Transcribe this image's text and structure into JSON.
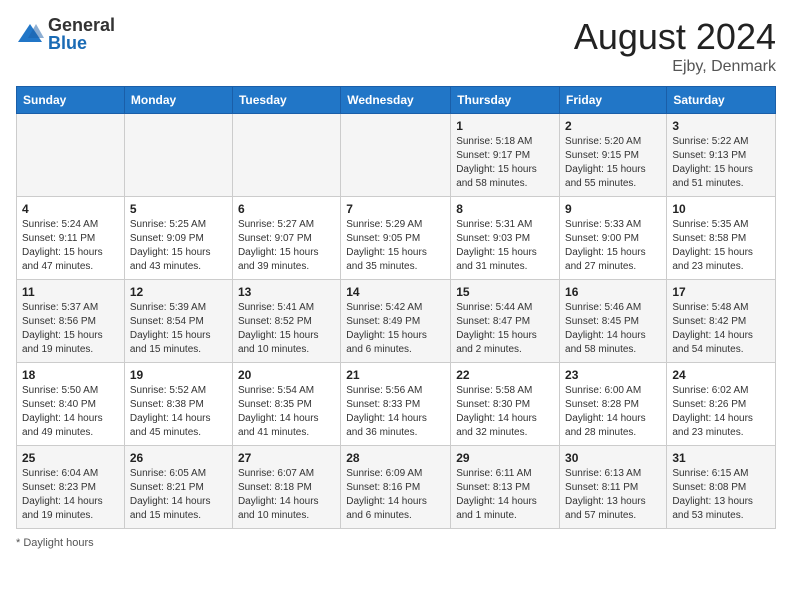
{
  "header": {
    "logo_general": "General",
    "logo_blue": "Blue",
    "month_title": "August 2024",
    "location": "Ejby, Denmark"
  },
  "days_of_week": [
    "Sunday",
    "Monday",
    "Tuesday",
    "Wednesday",
    "Thursday",
    "Friday",
    "Saturday"
  ],
  "weeks": [
    [
      {
        "day": "",
        "info": ""
      },
      {
        "day": "",
        "info": ""
      },
      {
        "day": "",
        "info": ""
      },
      {
        "day": "",
        "info": ""
      },
      {
        "day": "1",
        "info": "Sunrise: 5:18 AM\nSunset: 9:17 PM\nDaylight: 15 hours\nand 58 minutes."
      },
      {
        "day": "2",
        "info": "Sunrise: 5:20 AM\nSunset: 9:15 PM\nDaylight: 15 hours\nand 55 minutes."
      },
      {
        "day": "3",
        "info": "Sunrise: 5:22 AM\nSunset: 9:13 PM\nDaylight: 15 hours\nand 51 minutes."
      }
    ],
    [
      {
        "day": "4",
        "info": "Sunrise: 5:24 AM\nSunset: 9:11 PM\nDaylight: 15 hours\nand 47 minutes."
      },
      {
        "day": "5",
        "info": "Sunrise: 5:25 AM\nSunset: 9:09 PM\nDaylight: 15 hours\nand 43 minutes."
      },
      {
        "day": "6",
        "info": "Sunrise: 5:27 AM\nSunset: 9:07 PM\nDaylight: 15 hours\nand 39 minutes."
      },
      {
        "day": "7",
        "info": "Sunrise: 5:29 AM\nSunset: 9:05 PM\nDaylight: 15 hours\nand 35 minutes."
      },
      {
        "day": "8",
        "info": "Sunrise: 5:31 AM\nSunset: 9:03 PM\nDaylight: 15 hours\nand 31 minutes."
      },
      {
        "day": "9",
        "info": "Sunrise: 5:33 AM\nSunset: 9:00 PM\nDaylight: 15 hours\nand 27 minutes."
      },
      {
        "day": "10",
        "info": "Sunrise: 5:35 AM\nSunset: 8:58 PM\nDaylight: 15 hours\nand 23 minutes."
      }
    ],
    [
      {
        "day": "11",
        "info": "Sunrise: 5:37 AM\nSunset: 8:56 PM\nDaylight: 15 hours\nand 19 minutes."
      },
      {
        "day": "12",
        "info": "Sunrise: 5:39 AM\nSunset: 8:54 PM\nDaylight: 15 hours\nand 15 minutes."
      },
      {
        "day": "13",
        "info": "Sunrise: 5:41 AM\nSunset: 8:52 PM\nDaylight: 15 hours\nand 10 minutes."
      },
      {
        "day": "14",
        "info": "Sunrise: 5:42 AM\nSunset: 8:49 PM\nDaylight: 15 hours\nand 6 minutes."
      },
      {
        "day": "15",
        "info": "Sunrise: 5:44 AM\nSunset: 8:47 PM\nDaylight: 15 hours\nand 2 minutes."
      },
      {
        "day": "16",
        "info": "Sunrise: 5:46 AM\nSunset: 8:45 PM\nDaylight: 14 hours\nand 58 minutes."
      },
      {
        "day": "17",
        "info": "Sunrise: 5:48 AM\nSunset: 8:42 PM\nDaylight: 14 hours\nand 54 minutes."
      }
    ],
    [
      {
        "day": "18",
        "info": "Sunrise: 5:50 AM\nSunset: 8:40 PM\nDaylight: 14 hours\nand 49 minutes."
      },
      {
        "day": "19",
        "info": "Sunrise: 5:52 AM\nSunset: 8:38 PM\nDaylight: 14 hours\nand 45 minutes."
      },
      {
        "day": "20",
        "info": "Sunrise: 5:54 AM\nSunset: 8:35 PM\nDaylight: 14 hours\nand 41 minutes."
      },
      {
        "day": "21",
        "info": "Sunrise: 5:56 AM\nSunset: 8:33 PM\nDaylight: 14 hours\nand 36 minutes."
      },
      {
        "day": "22",
        "info": "Sunrise: 5:58 AM\nSunset: 8:30 PM\nDaylight: 14 hours\nand 32 minutes."
      },
      {
        "day": "23",
        "info": "Sunrise: 6:00 AM\nSunset: 8:28 PM\nDaylight: 14 hours\nand 28 minutes."
      },
      {
        "day": "24",
        "info": "Sunrise: 6:02 AM\nSunset: 8:26 PM\nDaylight: 14 hours\nand 23 minutes."
      }
    ],
    [
      {
        "day": "25",
        "info": "Sunrise: 6:04 AM\nSunset: 8:23 PM\nDaylight: 14 hours\nand 19 minutes."
      },
      {
        "day": "26",
        "info": "Sunrise: 6:05 AM\nSunset: 8:21 PM\nDaylight: 14 hours\nand 15 minutes."
      },
      {
        "day": "27",
        "info": "Sunrise: 6:07 AM\nSunset: 8:18 PM\nDaylight: 14 hours\nand 10 minutes."
      },
      {
        "day": "28",
        "info": "Sunrise: 6:09 AM\nSunset: 8:16 PM\nDaylight: 14 hours\nand 6 minutes."
      },
      {
        "day": "29",
        "info": "Sunrise: 6:11 AM\nSunset: 8:13 PM\nDaylight: 14 hours\nand 1 minute."
      },
      {
        "day": "30",
        "info": "Sunrise: 6:13 AM\nSunset: 8:11 PM\nDaylight: 13 hours\nand 57 minutes."
      },
      {
        "day": "31",
        "info": "Sunrise: 6:15 AM\nSunset: 8:08 PM\nDaylight: 13 hours\nand 53 minutes."
      }
    ]
  ],
  "legend": "Daylight hours"
}
